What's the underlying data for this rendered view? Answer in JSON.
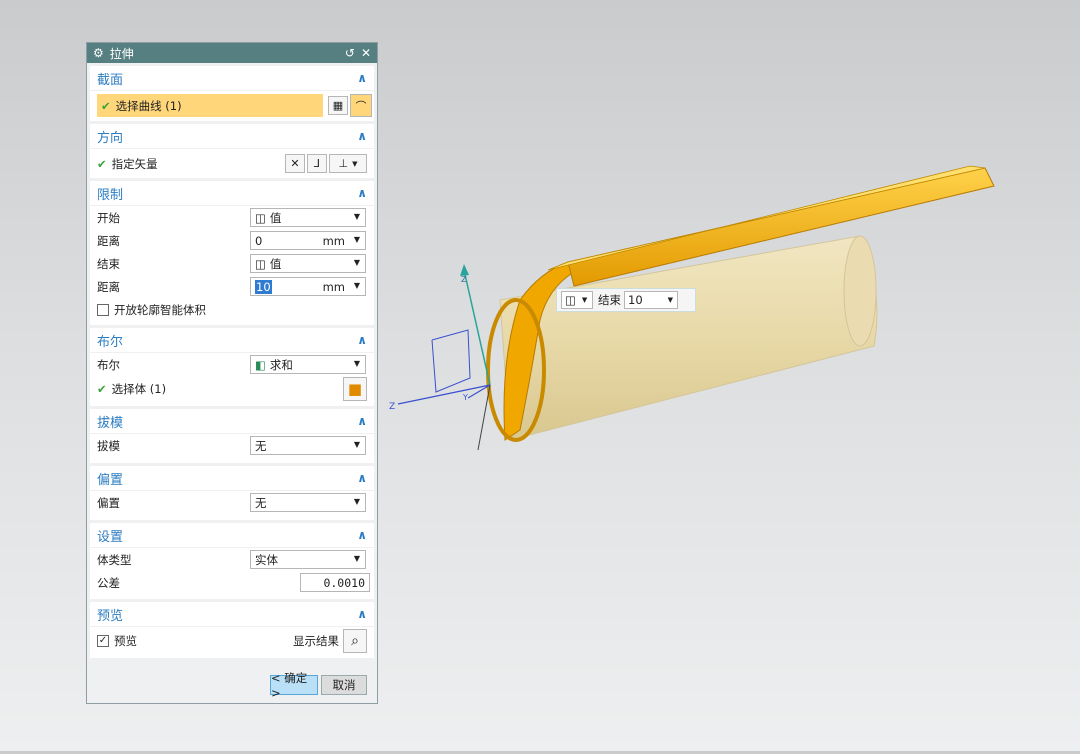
{
  "dialog": {
    "title": "拉伸"
  },
  "section_panel": {
    "title": "截面",
    "select_curve": "选择曲线 (1)"
  },
  "direction": {
    "title": "方向",
    "specify_vector": "指定矢量"
  },
  "limits": {
    "title": "限制",
    "start_label": "开始",
    "start_value": "值",
    "start_dist_label": "距离",
    "start_dist": "0",
    "unit1": "mm",
    "end_label": "结束",
    "end_value": "值",
    "end_dist_label": "距离",
    "end_dist": "10",
    "unit2": "mm",
    "open_profile": "开放轮廓智能体积"
  },
  "boolean": {
    "title": "布尔",
    "label": "布尔",
    "value": "求和",
    "select_body": "选择体 (1)"
  },
  "draft": {
    "title": "拔模",
    "label": "拔模",
    "value": "无"
  },
  "offset": {
    "title": "偏置",
    "label": "偏置",
    "value": "无"
  },
  "settings": {
    "title": "设置",
    "body_type_label": "体类型",
    "body_type": "实体",
    "tolerance_label": "公差",
    "tolerance": "0.0010"
  },
  "preview": {
    "title": "预览",
    "preview_label": "预览",
    "show_result": "显示结果"
  },
  "buttons": {
    "ok": "< 确定 >",
    "cancel": "取消"
  },
  "float_toolbar": {
    "end_label": "结束",
    "end_value": "10"
  },
  "axes": {
    "x": "X",
    "y": "Y",
    "z": "Z"
  },
  "colors": {
    "title_bar": "#557f80",
    "group_title": "#2c7cc2",
    "highlight": "#ffd77a",
    "model_orange": "#f5b820"
  }
}
